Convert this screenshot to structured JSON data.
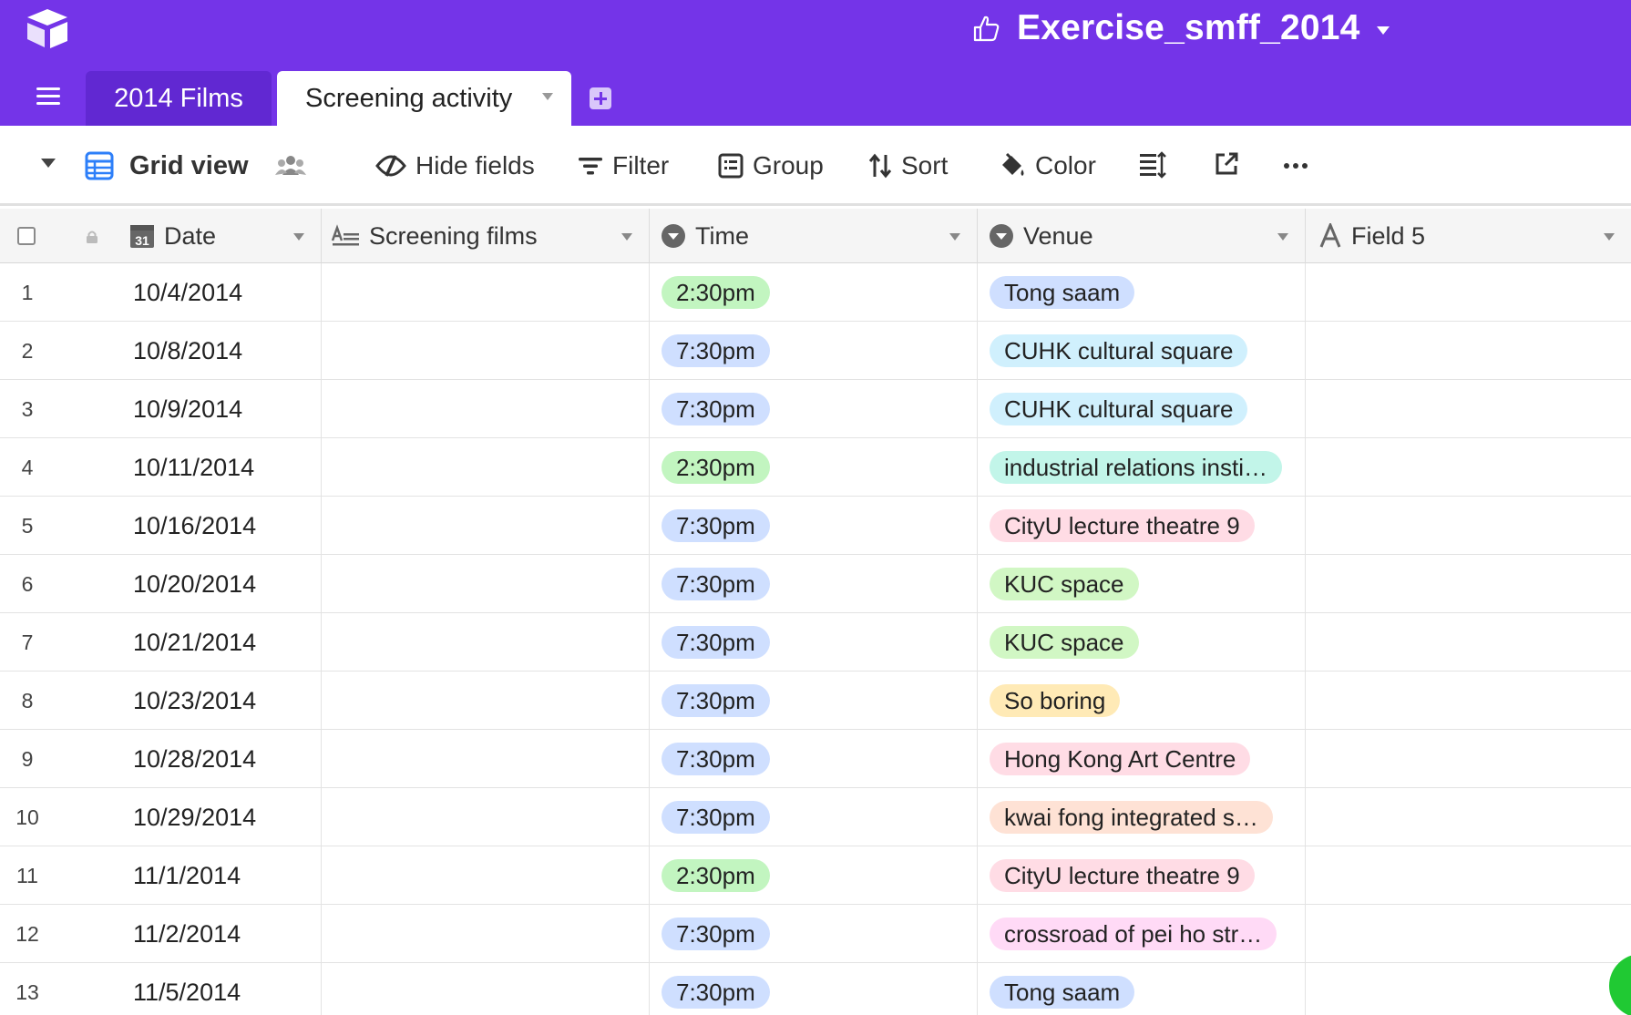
{
  "base": {
    "title": "Exercise_smff_2014"
  },
  "tabs": [
    {
      "label": "2014 Films",
      "active": false
    },
    {
      "label": "Screening activity",
      "active": true
    }
  ],
  "view": {
    "name": "Grid view",
    "toolbar": {
      "hide_fields": "Hide fields",
      "filter": "Filter",
      "group": "Group",
      "sort": "Sort",
      "color": "Color"
    }
  },
  "columns": {
    "date": "Date",
    "films": "Screening films",
    "time": "Time",
    "venue": "Venue",
    "field5": "Field 5"
  },
  "colors": {
    "brand": "#7434e8",
    "tab_inactive": "#6128d2",
    "time_2_30": "#c2f5c0",
    "time_7_30": "#cfdfff",
    "venue_tong_saam": "#cfdfff",
    "venue_cuhk": "#d0f0fd",
    "venue_industrial": "#c2f5e9",
    "venue_cityu": "#ffdce5",
    "venue_kuc": "#d1f7c4",
    "venue_so_boring": "#ffeab6",
    "venue_hkac": "#ffdce5",
    "venue_kwai_fong": "#fee2d5",
    "venue_crossroad": "#ffdaf6"
  },
  "rows": [
    {
      "num": "1",
      "date": "10/4/2014",
      "time": "2:30pm",
      "venue": "Tong saam",
      "time_color": "#c2f5c0",
      "venue_color": "#cfdfff"
    },
    {
      "num": "2",
      "date": "10/8/2014",
      "time": "7:30pm",
      "venue": "CUHK cultural square",
      "time_color": "#cfdfff",
      "venue_color": "#d0f0fd"
    },
    {
      "num": "3",
      "date": "10/9/2014",
      "time": "7:30pm",
      "venue": "CUHK cultural square",
      "time_color": "#cfdfff",
      "venue_color": "#d0f0fd"
    },
    {
      "num": "4",
      "date": "10/11/2014",
      "time": "2:30pm",
      "venue": "industrial relations insti…",
      "time_color": "#c2f5c0",
      "venue_color": "#c2f5e9"
    },
    {
      "num": "5",
      "date": "10/16/2014",
      "time": "7:30pm",
      "venue": "CityU lecture theatre 9",
      "time_color": "#cfdfff",
      "venue_color": "#ffdce5"
    },
    {
      "num": "6",
      "date": "10/20/2014",
      "time": "7:30pm",
      "venue": "KUC space",
      "time_color": "#cfdfff",
      "venue_color": "#d1f7c4"
    },
    {
      "num": "7",
      "date": "10/21/2014",
      "time": "7:30pm",
      "venue": "KUC space",
      "time_color": "#cfdfff",
      "venue_color": "#d1f7c4"
    },
    {
      "num": "8",
      "date": "10/23/2014",
      "time": "7:30pm",
      "venue": "So boring",
      "time_color": "#cfdfff",
      "venue_color": "#ffeab6"
    },
    {
      "num": "9",
      "date": "10/28/2014",
      "time": "7:30pm",
      "venue": "Hong Kong Art Centre",
      "time_color": "#cfdfff",
      "venue_color": "#ffdce5"
    },
    {
      "num": "10",
      "date": "10/29/2014",
      "time": "7:30pm",
      "venue": "kwai fong integrated s…",
      "time_color": "#cfdfff",
      "venue_color": "#fee2d5"
    },
    {
      "num": "11",
      "date": "11/1/2014",
      "time": "2:30pm",
      "venue": "CityU lecture theatre 9",
      "time_color": "#c2f5c0",
      "venue_color": "#ffdce5"
    },
    {
      "num": "12",
      "date": "11/2/2014",
      "time": "7:30pm",
      "venue": "crossroad of pei ho str…",
      "time_color": "#cfdfff",
      "venue_color": "#ffdaf6"
    },
    {
      "num": "13",
      "date": "11/5/2014",
      "time": "7:30pm",
      "venue": "Tong saam",
      "time_color": "#cfdfff",
      "venue_color": "#cfdfff"
    }
  ]
}
